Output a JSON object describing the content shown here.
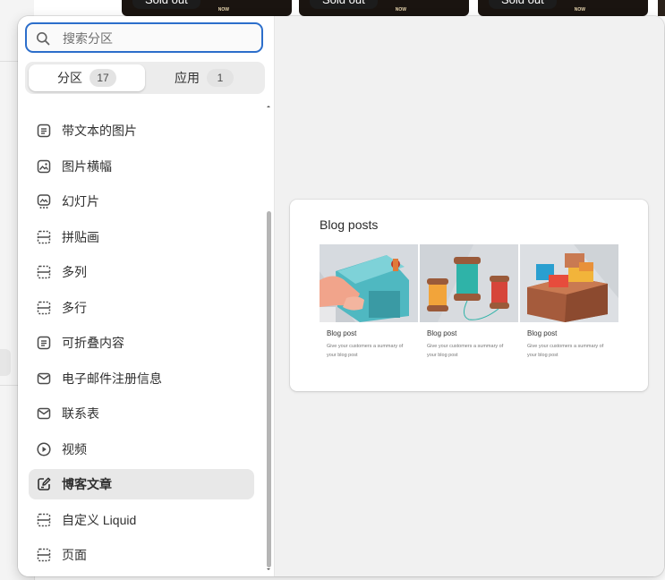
{
  "background": {
    "cards": [
      {
        "badge": "Sold out",
        "tag": "NOW"
      },
      {
        "badge": "Sold out",
        "tag": "NOW"
      },
      {
        "badge": "Sold out",
        "tag": "NOW"
      }
    ]
  },
  "search": {
    "placeholder": "搜索分区",
    "value": ""
  },
  "tabs": [
    {
      "label": "分区",
      "count": "17",
      "active": true
    },
    {
      "label": "应用",
      "count": "1",
      "active": false
    }
  ],
  "sections": [
    {
      "label": "带文本的图片",
      "icon": "text-lines-icon"
    },
    {
      "label": "图片横幅",
      "icon": "image-icon"
    },
    {
      "label": "幻灯片",
      "icon": "slideshow-icon"
    },
    {
      "label": "拼贴画",
      "icon": "layout-icon"
    },
    {
      "label": "多列",
      "icon": "layout-icon"
    },
    {
      "label": "多行",
      "icon": "layout-icon"
    },
    {
      "label": "可折叠内容",
      "icon": "text-lines-icon"
    },
    {
      "label": "电子邮件注册信息",
      "icon": "email-icon"
    },
    {
      "label": "联系表",
      "icon": "email-icon"
    },
    {
      "label": "视频",
      "icon": "play-icon"
    },
    {
      "label": "博客文章",
      "icon": "compose-icon",
      "selected": true
    },
    {
      "label": "自定义 Liquid",
      "icon": "layout-icon"
    },
    {
      "label": "页面",
      "icon": "layout-icon"
    }
  ],
  "preview": {
    "title": "Blog posts",
    "posts": [
      {
        "title": "Blog post",
        "description": "Give your customers a summary of your blog post",
        "image": "sewing-machine"
      },
      {
        "title": "Blog post",
        "description": "Give your customers a summary of your blog post",
        "image": "thread-spools"
      },
      {
        "title": "Blog post",
        "description": "Give your customers a summary of your blog post",
        "image": "shipping-boxes"
      }
    ]
  },
  "colors": {
    "accent": "#2c6ecb",
    "selected_bg": "#e8e8e8",
    "preview_bg": "#f1f1f1"
  }
}
